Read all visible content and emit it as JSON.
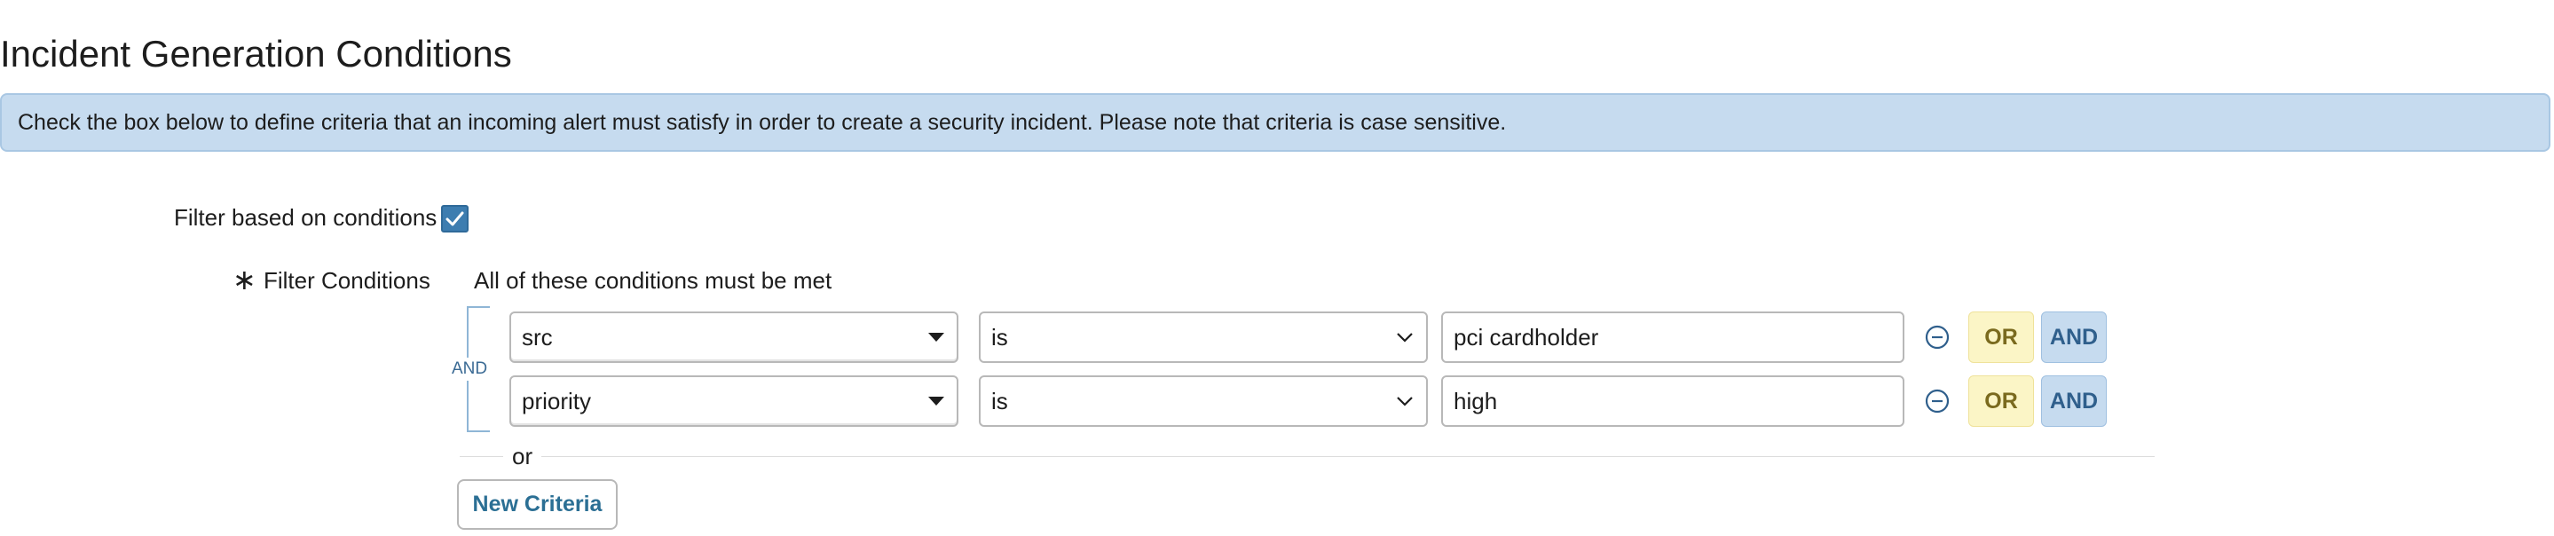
{
  "page": {
    "title": "Incident Generation Conditions",
    "info_message": "Check the box below to define criteria that an incoming alert must satisfy in order to create a security incident. Please note that criteria is case sensitive."
  },
  "filter": {
    "filter_label": "Filter based on conditions",
    "checked": true,
    "required_marker": "∗",
    "conditions_label": "Filter Conditions",
    "conditions_summary": "All of these conditions must be met",
    "group_operator": "AND",
    "rows": [
      {
        "field": "src",
        "operator": "is",
        "value": "pci cardholder",
        "or_label": "OR",
        "and_label": "AND"
      },
      {
        "field": "priority",
        "operator": "is",
        "value": "high",
        "or_label": "OR",
        "and_label": "AND"
      }
    ],
    "or_separator": "or",
    "new_criteria_label": "New Criteria"
  },
  "colors": {
    "info_bg": "#c6dbef",
    "checkbox": "#3d7db0",
    "or_button_bg": "#fbf5c6",
    "and_button_bg": "#c6dbef",
    "link_text": "#2b6f94"
  },
  "icons": [
    "check-icon",
    "caret-down-icon",
    "chevron-down-icon",
    "minus-circle-icon"
  ]
}
